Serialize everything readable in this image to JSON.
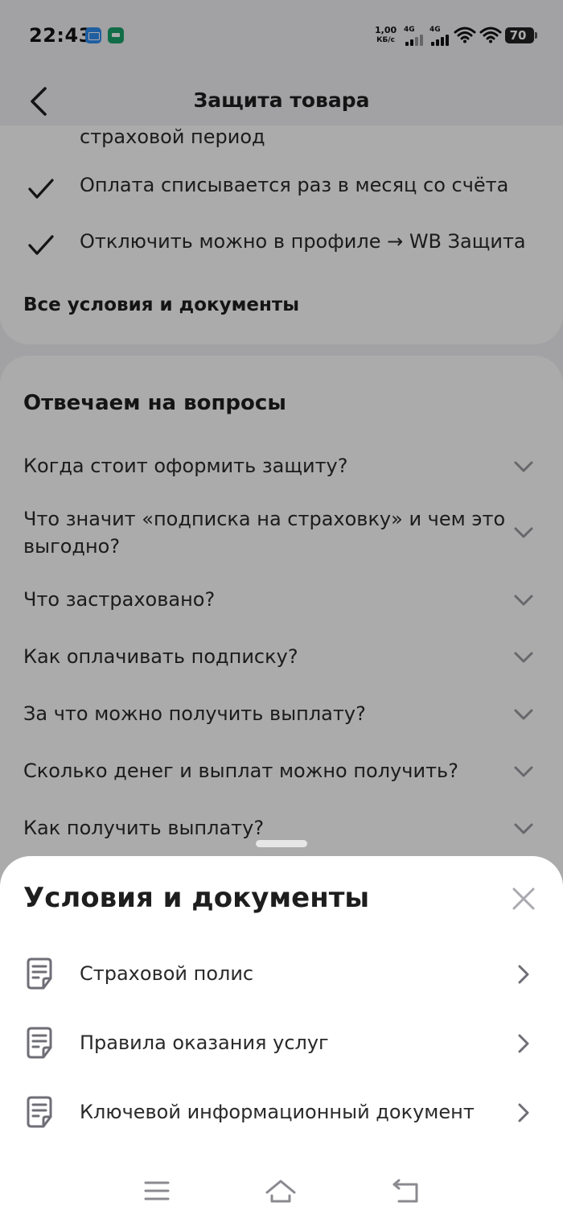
{
  "status_bar": {
    "time": "22:43",
    "speed_value": "1,00",
    "speed_unit": "КБ/с",
    "network1": "4G",
    "network2": "4G",
    "battery": "70"
  },
  "header": {
    "title": "Защита товара",
    "back_icon": "chevron-left-icon"
  },
  "benefits": {
    "cut_text": "страховой период",
    "items": [
      "Оплата списывается раз в месяц со счёта",
      "Отключить можно в профиле → WB Защита"
    ],
    "docs_link": "Все условия и документы"
  },
  "faq": {
    "title": "Отвечаем на вопросы",
    "items": [
      "Когда стоит оформить защиту?",
      "Что значит «подписка на страховку» и чем это выгодно?",
      "Что застраховано?",
      "Как оплачивать подписку?",
      "За что можно получить выплату?",
      "Сколько денег и выплат можно получить?",
      "Как получить выплату?"
    ]
  },
  "sheet": {
    "title": "Условия и документы",
    "close_icon": "close-icon",
    "documents": [
      "Страховой полис",
      "Правила оказания услуг",
      "Ключевой информационный документ"
    ]
  },
  "nav_bar": {
    "icons": [
      "menu-icon",
      "home-icon",
      "back-icon"
    ]
  },
  "colors": {
    "accent_text": "#242424",
    "muted_icon": "#9a9aa2",
    "sheet_bg": "#ffffff",
    "overlay": "rgba(0,0,0,0.33)"
  }
}
